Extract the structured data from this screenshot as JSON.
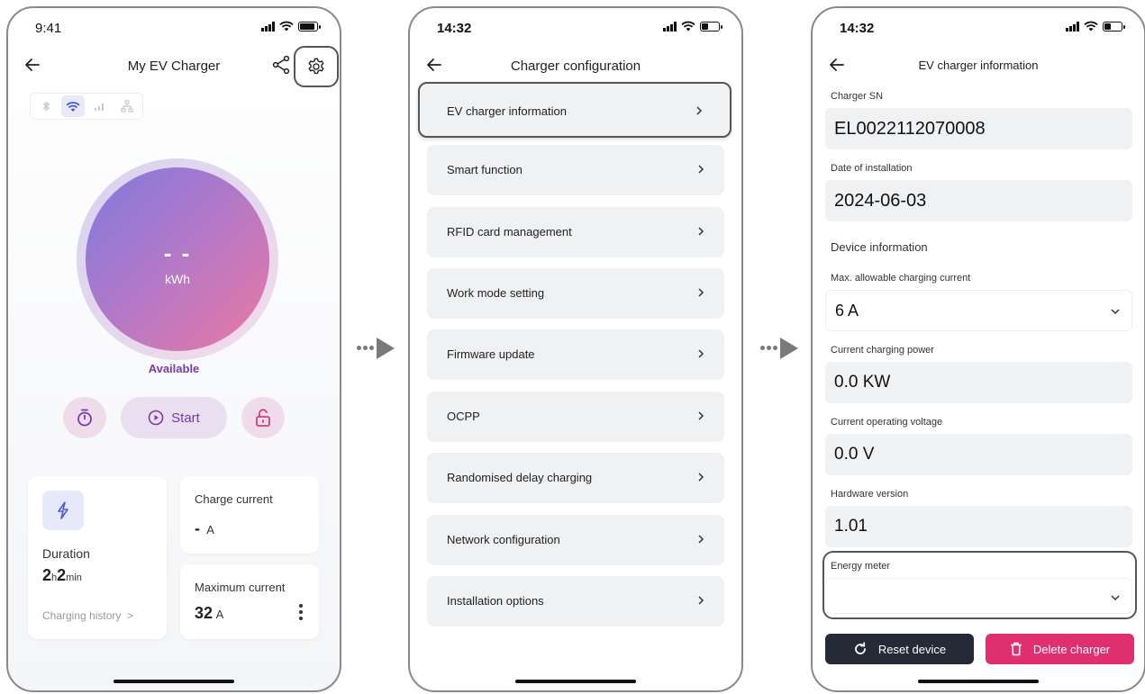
{
  "screen1": {
    "status_time": "9:41",
    "title": "My EV Charger",
    "energy_value": "- -",
    "energy_unit": "kWh",
    "status_label": "Available",
    "start_label": "Start",
    "duration_label": "Duration",
    "duration_hours": "2",
    "duration_hours_unit": "h",
    "duration_minutes": "2",
    "duration_minutes_unit": "min",
    "history_link": "Charging history",
    "history_chevron": ">",
    "charge_current_label": "Charge current",
    "charge_current_value": "-",
    "charge_current_unit": "A",
    "max_current_label": "Maximum current",
    "max_current_value": "32",
    "max_current_unit": "A",
    "colors": {
      "accent": "#7a3aa8",
      "orb_start": "#7e7ae0",
      "orb_end": "#ec78a3"
    }
  },
  "screen2": {
    "status_time": "14:32",
    "title": "Charger configuration",
    "menu": [
      "EV charger information",
      "Smart function",
      "RFID card management",
      "Work mode setting",
      "Firmware update",
      "OCPP",
      "Randomised delay charging",
      "Network configuration",
      "Installation options"
    ],
    "chevron": ">"
  },
  "screen3": {
    "status_time": "14:32",
    "title": "EV charger information",
    "sn_label": "Charger SN",
    "sn_value": "EL0022112070008",
    "install_label": "Date of installation",
    "install_value": "2024-06-03",
    "device_info_label": "Device information",
    "max_current_label": "Max. allowable charging current",
    "max_current_value": "6 A",
    "power_label": "Current charging power",
    "power_value": "0.0 KW",
    "voltage_label": "Current operating voltage",
    "voltage_value": "0.0 V",
    "hw_label": "Hardware version",
    "hw_value": "1.01",
    "energy_meter_label": "Energy meter",
    "energy_meter_value": "",
    "reset_label": "Reset device",
    "delete_label": "Delete charger",
    "colors": {
      "reset_bg": "#242a36",
      "delete_bg": "#df2f6f"
    }
  }
}
